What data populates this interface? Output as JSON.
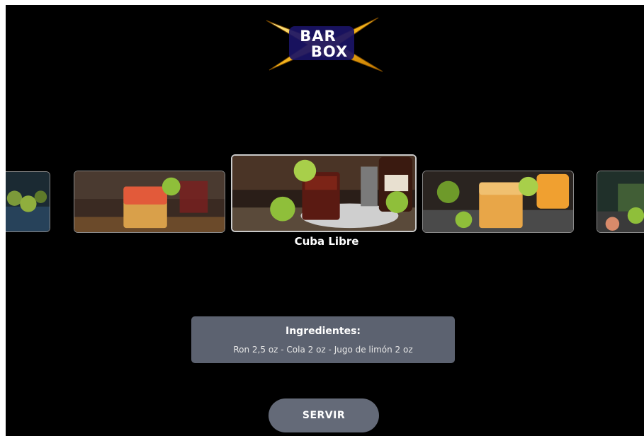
{
  "brand": {
    "line1": "BAR",
    "line2": "BOX"
  },
  "carousel": {
    "selected_name": "Cuba Libre",
    "cards": [
      {
        "name": "far-left-drink-card"
      },
      {
        "name": "tequila-sunrise-drink-card"
      },
      {
        "name": "cuba-libre-drink-card",
        "selected": true
      },
      {
        "name": "orange-lime-drink-card"
      },
      {
        "name": "far-right-drink-card"
      }
    ]
  },
  "ingredients": {
    "title": "Ingredientes:",
    "text": "Ron 2,5 oz - Cola 2 oz - Jugo de limón 2 oz"
  },
  "actions": {
    "serve_label": "SERVIR"
  },
  "colors": {
    "background": "#000000",
    "panel": "#5c6270",
    "button": "#646a78",
    "logo_star": "#f2b21a"
  }
}
